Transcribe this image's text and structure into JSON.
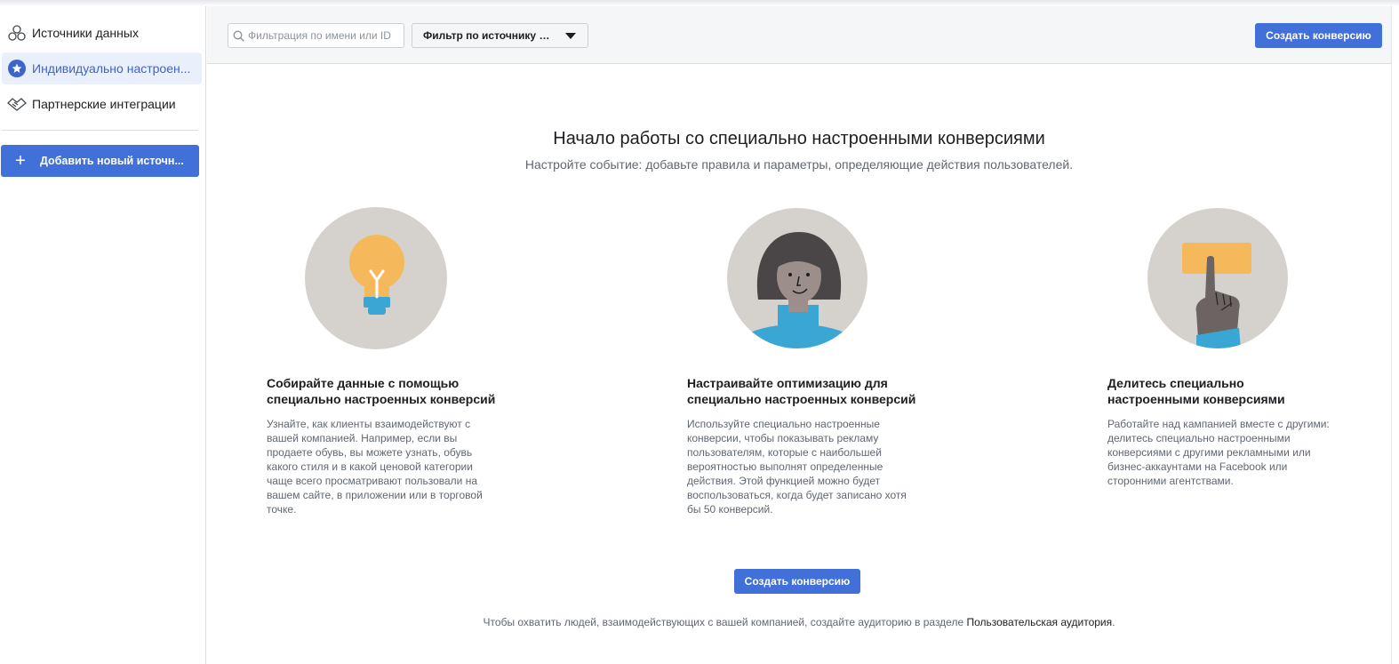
{
  "sidebar": {
    "items": [
      {
        "label": "Источники данных",
        "icon": "data-sources-icon"
      },
      {
        "label": "Индивидуально настроен...",
        "icon": "custom-conversions-icon",
        "active": true
      },
      {
        "label": "Партнерские интеграции",
        "icon": "partner-integrations-icon"
      }
    ],
    "add_button": "Добавить новый источн..."
  },
  "toolbar": {
    "search_placeholder": "Фильтрация по имени или ID",
    "filter_label": "Фильтр по источнику д...",
    "create_button": "Создать конверсию"
  },
  "main": {
    "title": "Начало работы со специально настроенными конверсиями",
    "subtitle": "Настройте событие: добавьте правила и параметры, определяющие действия пользователей.",
    "cards": [
      {
        "title": "Собирайте данные с помощью специально настроенных конверсий",
        "text": "Узнайте, как клиенты взаимодействуют с вашей компанией. Например, если вы продаете обувь, вы можете узнать, обувь какого стиля и в какой ценовой категории чаще всего просматривают пользовали на вашем сайте, в приложении или в торговой точке.",
        "icon": "lightbulb-illustration"
      },
      {
        "title": "Настраивайте оптимизацию для специально настроенных конверсий",
        "text": "Используйте специально настроенные конверсии, чтобы показывать рекламу пользователям, которые с наибольшей вероятностью выполнят определенные действия. Этой функцией можно будет воспользоваться, когда будет записано хотя бы 50 конверсий.",
        "icon": "person-illustration"
      },
      {
        "title": "Делитесь специально настроенными конверсиями",
        "text": "Работайте над кампанией вместе с другими: делитесь специально настроенными конверсиями с другими рекламными или бизнес-аккаунтами на Facebook или сторонними агентствами.",
        "icon": "hand-pointing-illustration"
      }
    ],
    "create_button": "Создать конверсию",
    "footer_text": "Чтобы охватить людей, взаимодействующих с вашей компанией, создайте аудиторию в разделе ",
    "footer_link": "Пользовательская аудитория",
    "footer_end": "."
  },
  "colors": {
    "accent": "#4170d8",
    "active_bg": "#eaf0fb",
    "illustration_bg": "#d5d2cd",
    "yellow": "#f5b95c",
    "blue": "#3aa6d4"
  }
}
